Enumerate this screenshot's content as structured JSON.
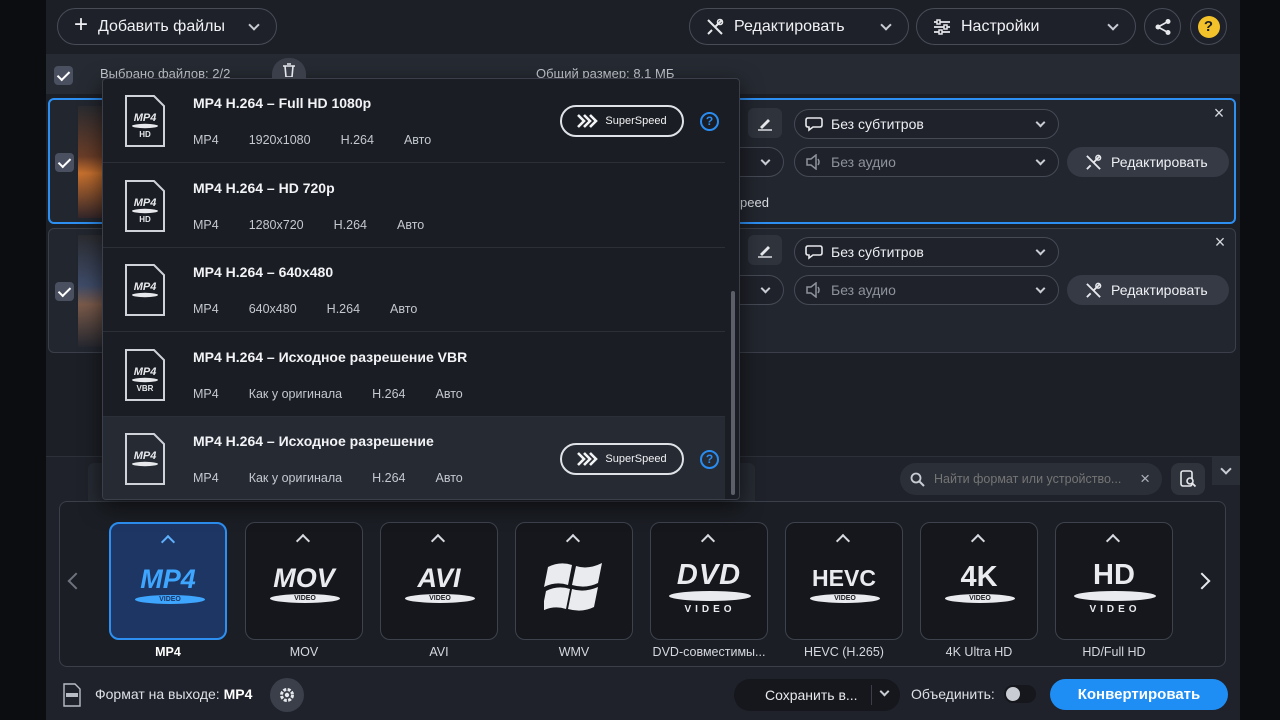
{
  "toolbar": {
    "add_files_label": "Добавить файлы",
    "edit_label": "Редактировать",
    "settings_label": "Настройки"
  },
  "files_bar": {
    "selected_label": "Выбрано файлов:",
    "selected_count": "2/2",
    "total_size_label": "Общий размер:",
    "total_size_value": "8,1 МБ"
  },
  "files": [
    {
      "subtitles": "Без субтитров",
      "audio": "Без аудио",
      "edit_label": "Редактировать",
      "note_fragment": "peed"
    },
    {
      "subtitles": "Без субтитров",
      "audio": "Без аудио",
      "edit_label": "Редактировать"
    }
  ],
  "presets": [
    {
      "title": "MP4 H.264 – Full HD 1080p",
      "icon_tag": "HD",
      "meta": [
        "MP4",
        "1920x1080",
        "H.264",
        "Авто"
      ],
      "superspeed": true
    },
    {
      "title": "MP4 H.264 – HD 720p",
      "icon_tag": "HD",
      "meta": [
        "MP4",
        "1280x720",
        "H.264",
        "Авто"
      ],
      "superspeed": false
    },
    {
      "title": "MP4 H.264 – 640x480",
      "icon_tag": "",
      "meta": [
        "MP4",
        "640x480",
        "H.264",
        "Авто"
      ],
      "superspeed": false
    },
    {
      "title": "MP4 H.264 – Исходное разрешение VBR",
      "icon_tag": "VBR",
      "meta": [
        "MP4",
        "Как у оригинала",
        "H.264",
        "Авто"
      ],
      "superspeed": false
    },
    {
      "title": "MP4 H.264 – Исходное разрешение",
      "icon_tag": "",
      "meta": [
        "MP4",
        "Как у оригинала",
        "H.264",
        "Авто"
      ],
      "superspeed": true,
      "highlighted": true
    }
  ],
  "preset_icon_text": "MP4",
  "superspeed_label": "SuperSpeed",
  "search": {
    "placeholder": "Найти формат или устройство..."
  },
  "formats": [
    {
      "label": "MP4",
      "logo": "MP4",
      "active": true
    },
    {
      "label": "MOV",
      "logo": "MOV"
    },
    {
      "label": "AVI",
      "logo": "AVI"
    },
    {
      "label": "WMV",
      "logo": "windows-logo"
    },
    {
      "label": "DVD-совместимы...",
      "logo": "DVD"
    },
    {
      "label": "HEVC (H.265)",
      "logo": "HEVC"
    },
    {
      "label": "4K Ultra HD",
      "logo": "4K"
    },
    {
      "label": "HD/Full HD",
      "logo": "HD"
    }
  ],
  "format_logo_subtext": "VIDEO",
  "footer": {
    "output_format_label": "Формат на выходе:",
    "output_format_value": "MP4",
    "save_label": "Сохранить в...",
    "merge_label": "Объединить:",
    "convert_label": "Конвертировать"
  },
  "colors": {
    "accent": "#2a8cf0",
    "convert_button": "#1e8ef5",
    "active_tile_bg": "#1d3664"
  }
}
